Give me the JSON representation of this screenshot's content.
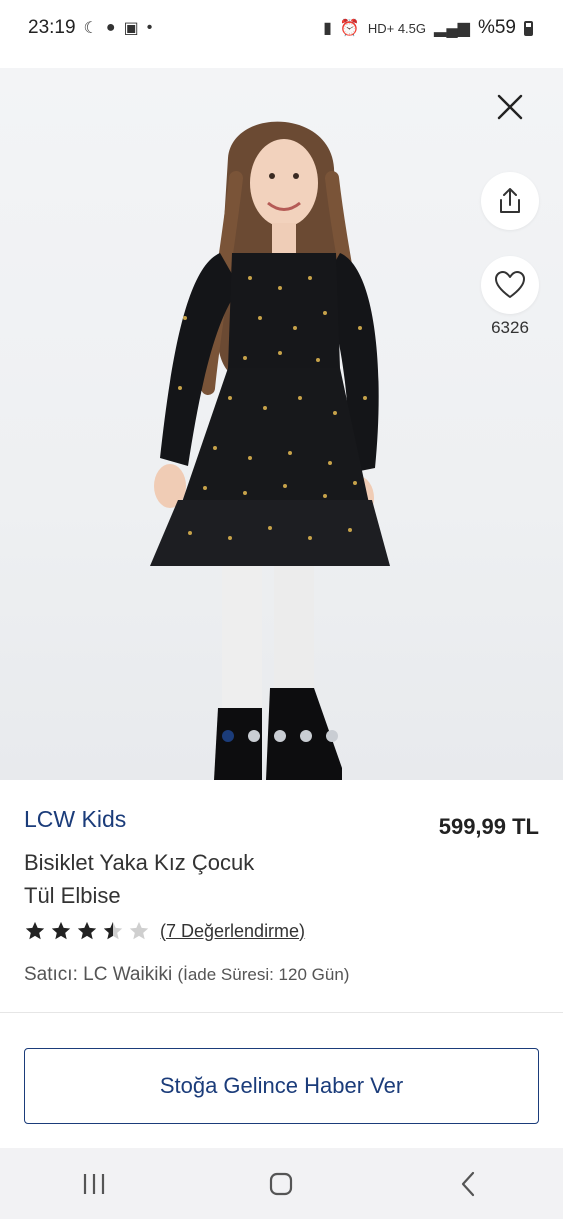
{
  "status_bar": {
    "time": "23:19",
    "left_icons": [
      "moon-icon",
      "chat-icon",
      "gallery-icon",
      "dot-icon"
    ],
    "right_icons": [
      "sim-icon",
      "alarm-icon",
      "hd-icon",
      "network-icon",
      "signal-icon"
    ],
    "network_label": "HD+ 4.5G",
    "battery": "%59"
  },
  "product_image": {
    "favorite_count": "6326",
    "carousel_total": 5,
    "carousel_active": 1
  },
  "product": {
    "brand": "LCW Kids",
    "title": "Bisiklet Yaka Kız Çocuk Tül Elbise",
    "price": "599,99 TL",
    "rating": 3.5,
    "reviews_label": "(7 Değerlendirme)",
    "seller_label": "Satıcı: LC Waikiki",
    "return_label": "(İade Süresi: 120 Gün)"
  },
  "actions": {
    "notify_label": "Stoğa Gelince Haber Ver"
  },
  "colors": {
    "brand_blue": "#1b3c7a",
    "dot_active": "#1b3c7a",
    "dot_inactive": "#c9cdd3"
  },
  "nav_bar": {
    "items": [
      "recent-apps-icon",
      "home-icon",
      "back-icon"
    ]
  }
}
